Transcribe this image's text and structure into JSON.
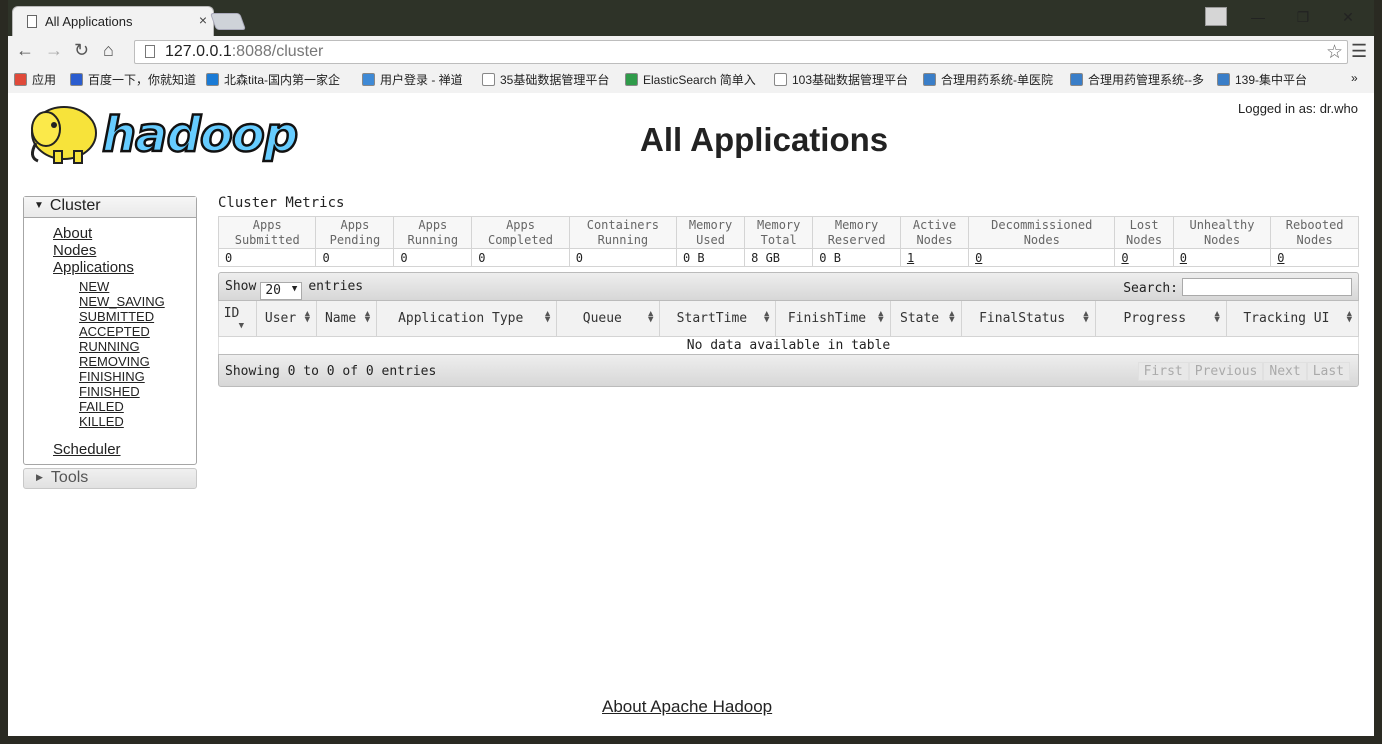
{
  "browser": {
    "tab_title": "All Applications",
    "tab_close": "×",
    "url_host": "127.0.0.1",
    "url_rest": ":8088/cluster",
    "window_buttons": [
      "—",
      "❐",
      "✕"
    ],
    "bookmarks": [
      {
        "label": "应用",
        "color": "#e04a3a"
      },
      {
        "label": "百度一下，你就知道",
        "color": "#2b5dcf"
      },
      {
        "label": "北森tita-国内第一家企",
        "color": "#1a7bd6"
      },
      {
        "label": "用户登录 - 禅道",
        "color": "#3f8ad6"
      },
      {
        "label": "35基础数据管理平台",
        "color": "#ffffff"
      },
      {
        "label": "ElasticSearch 简单入",
        "color": "#2f9b4a"
      },
      {
        "label": "103基础数据管理平台",
        "color": "#ffffff"
      },
      {
        "label": "合理用药系统-单医院",
        "color": "#3a7ec8"
      },
      {
        "label": "合理用药管理系统--多",
        "color": "#3a7ec8"
      },
      {
        "label": "139-集中平台",
        "color": "#3a7ec8"
      }
    ],
    "more_bookmarks": "»"
  },
  "header": {
    "logo_text": "hadoop",
    "login": "Logged in as: dr.who",
    "title": "All Applications"
  },
  "nav": {
    "cluster_label": "Cluster",
    "links": [
      "About",
      "Nodes",
      "Applications"
    ],
    "app_states": [
      "NEW",
      "NEW_SAVING",
      "SUBMITTED",
      "ACCEPTED",
      "RUNNING",
      "REMOVING",
      "FINISHING",
      "FINISHED",
      "FAILED",
      "KILLED"
    ],
    "scheduler": "Scheduler",
    "tools_label": "Tools"
  },
  "metrics": {
    "title": "Cluster Metrics",
    "headers": [
      [
        "Apps",
        "Submitted"
      ],
      [
        "Apps",
        "Pending"
      ],
      [
        "Apps",
        "Running"
      ],
      [
        "Apps",
        "Completed"
      ],
      [
        "Containers",
        "Running"
      ],
      [
        "Memory",
        "Used"
      ],
      [
        "Memory",
        "Total"
      ],
      [
        "Memory",
        "Reserved"
      ],
      [
        "Active",
        "Nodes"
      ],
      [
        "Decommissioned",
        "Nodes"
      ],
      [
        "Lost",
        "Nodes"
      ],
      [
        "Unhealthy",
        "Nodes"
      ],
      [
        "Rebooted",
        "Nodes"
      ]
    ],
    "values": [
      "0",
      "0",
      "0",
      "0",
      "0",
      "0 B",
      "8 GB",
      "0 B",
      "1",
      "0",
      "0",
      "0",
      "0"
    ],
    "linked": [
      false,
      false,
      false,
      false,
      false,
      false,
      false,
      false,
      true,
      true,
      true,
      true,
      true
    ]
  },
  "table": {
    "show_label": "Show",
    "page_size": "20",
    "entries_label": "entries",
    "search_label": "Search:",
    "columns": [
      "ID",
      "User",
      "Name",
      "Application Type",
      "Queue",
      "StartTime",
      "FinishTime",
      "State",
      "FinalStatus",
      "Progress",
      "Tracking UI"
    ],
    "empty_message": "No data available in table",
    "info": "Showing 0 to 0 of 0 entries",
    "pager": [
      "First",
      "Previous",
      "Next",
      "Last"
    ]
  },
  "footer": {
    "link": "About Apache Hadoop"
  }
}
